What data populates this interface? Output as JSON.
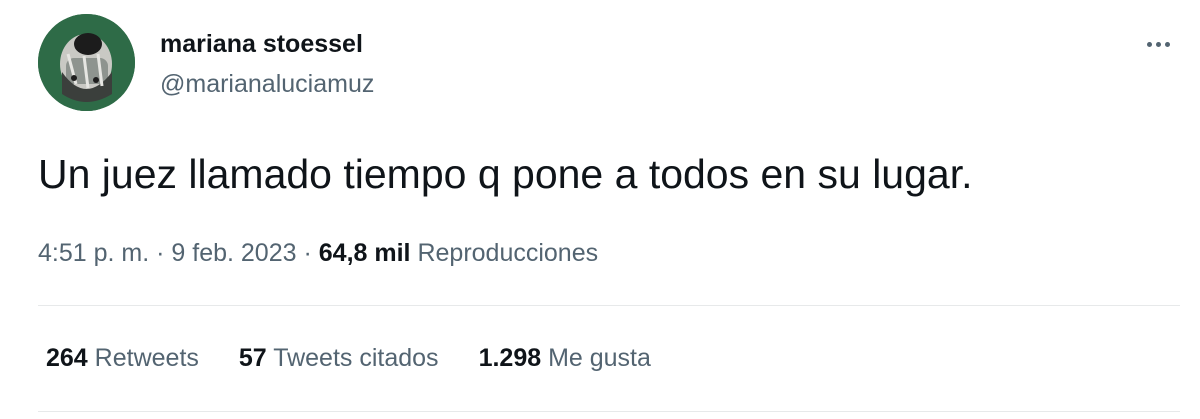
{
  "user": {
    "display_name": "mariana stoessel",
    "handle": "@marianaluciamuz",
    "avatar_icon": "avatar-photo"
  },
  "tweet": {
    "text": "Un juez llamado tiempo q pone a todos en su lugar.",
    "time": "4:51 p. m.",
    "separator": "·",
    "date": "9 feb. 2023",
    "views_count": "64,8 mil",
    "views_label": "Reproducciones"
  },
  "stats": {
    "retweets_count": "264",
    "retweets_label": "Retweets",
    "quotes_count": "57",
    "quotes_label": "Tweets citados",
    "likes_count": "1.298",
    "likes_label": "Me gusta"
  },
  "icons": {
    "more": "more-horizontal-icon"
  },
  "colors": {
    "text_primary": "#0f1419",
    "text_secondary": "#536471",
    "divider": "#e7e9ea"
  }
}
